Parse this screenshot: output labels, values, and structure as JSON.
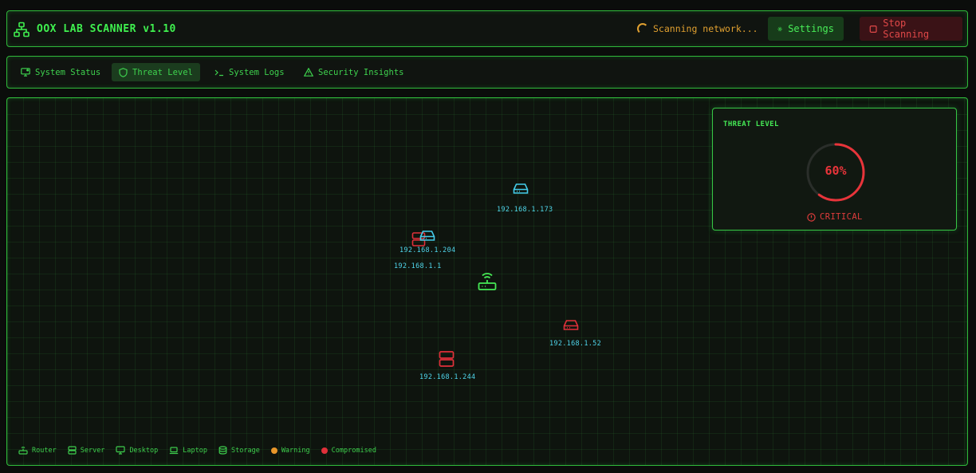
{
  "header": {
    "title": "OOX LAB SCANNER v1.10",
    "scan_status": "Scanning network...",
    "settings_label": "Settings",
    "stop_label": "Stop Scanning"
  },
  "nav": {
    "tabs": [
      {
        "label": "System Status",
        "icon": "monitor-icon"
      },
      {
        "label": "Threat Level",
        "icon": "shield-icon",
        "active": true
      },
      {
        "label": "System Logs",
        "icon": "terminal-icon"
      },
      {
        "label": "Security Insights",
        "icon": "alert-triangle-icon"
      }
    ]
  },
  "map": {
    "nodes": [
      {
        "ip": "192.168.1.173",
        "type": "storage",
        "status": "normal"
      },
      {
        "ip": "192.168.1.204",
        "type": "storage",
        "status": "normal"
      },
      {
        "ip": "192.168.1.1",
        "type": "server",
        "status": "compromised"
      },
      {
        "ip": "",
        "type": "router",
        "status": "normal"
      },
      {
        "ip": "192.168.1.52",
        "type": "storage",
        "status": "compromised"
      },
      {
        "ip": "192.168.1.244",
        "type": "server",
        "status": "compromised"
      }
    ]
  },
  "threat": {
    "title": "THREAT LEVEL",
    "percent_label": "60%",
    "level": 0.6,
    "status": "CRITICAL"
  },
  "legend": {
    "router": "Router",
    "server": "Server",
    "desktop": "Desktop",
    "laptop": "Laptop",
    "storage": "Storage",
    "warning": "Warning",
    "compromised": "Compromised"
  },
  "colors": {
    "accent": "#39e04a",
    "ip_text": "#4fd4ea",
    "compromised": "#e0303a",
    "warning": "#e8962a"
  }
}
